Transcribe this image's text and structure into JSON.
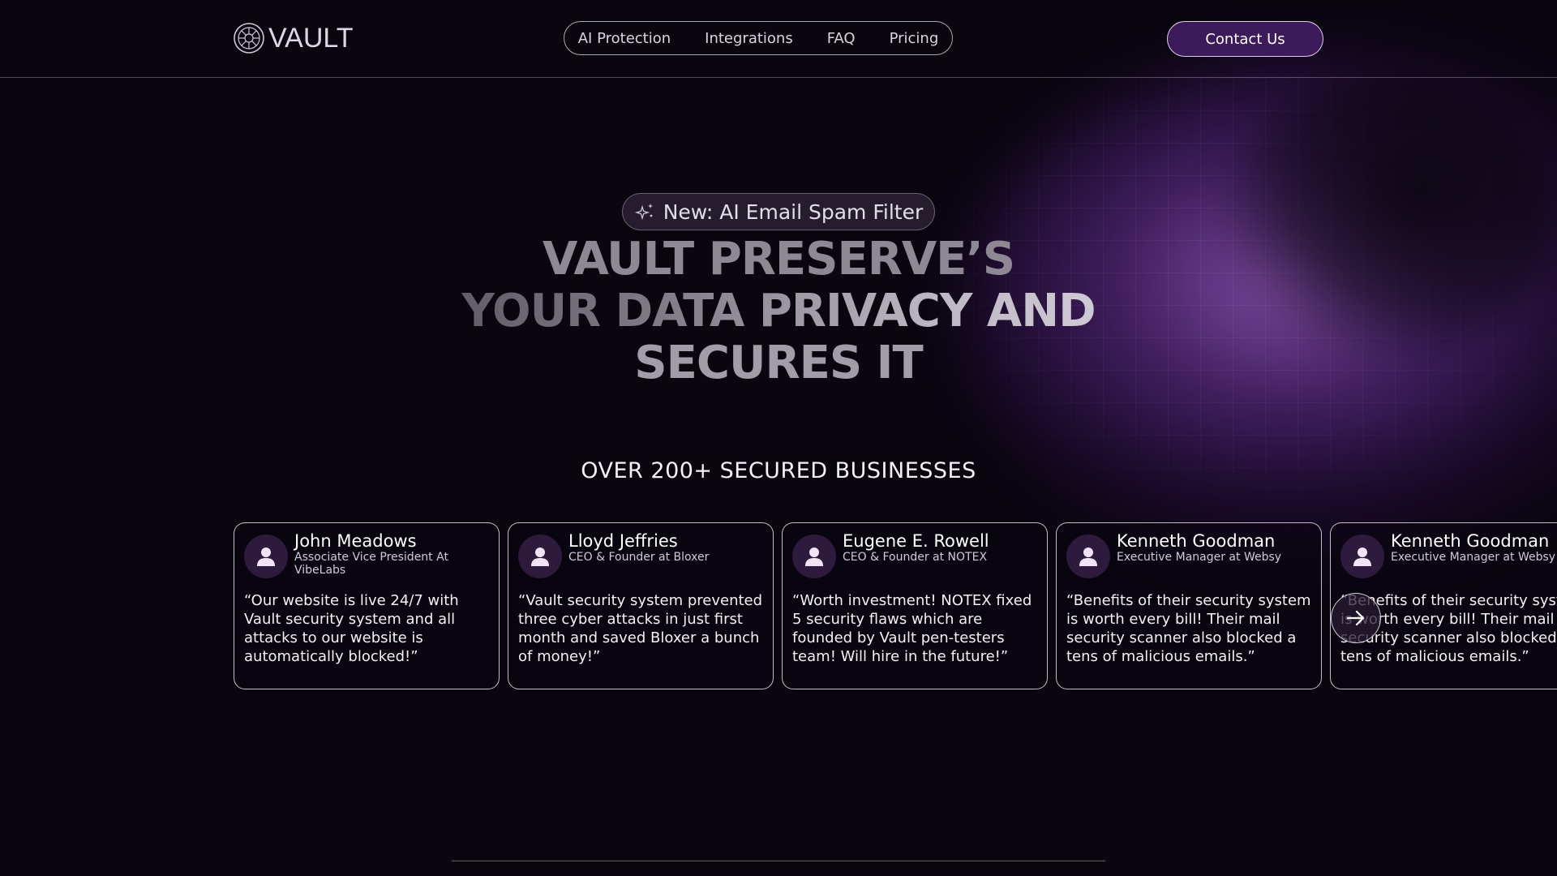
{
  "header": {
    "logo_text": "VAULT",
    "nav": [
      {
        "label": "AI Protection"
      },
      {
        "label": "Integrations"
      },
      {
        "label": "FAQ"
      },
      {
        "label": "Pricing"
      }
    ],
    "contact_label": "Contact Us"
  },
  "hero": {
    "badge_text": "New: AI Email Spam Filter",
    "title_lines": [
      "VAULT PRESERVE’S",
      "YOUR DATA PRIVACY AND",
      "SECURES IT"
    ],
    "secured_text": "OVER 200+ SECURED BUSINESSES"
  },
  "testimonials": [
    {
      "name": "John Meadows",
      "role": "Associate Vice President At VibeLabs",
      "quote": "“Our website is live 24/7 with Vault security system and all attacks to our website is automatically blocked!”"
    },
    {
      "name": "Lloyd Jeffries",
      "role": "CEO & Founder at Bloxer",
      "quote": "“Vault security system prevented three cyber attacks in just first month and saved Bloxer a bunch of money!”"
    },
    {
      "name": "Eugene E. Rowell",
      "role": "CEO & Founder at NOTEX",
      "quote": "“Worth investment! NOTEX fixed 5 security flaws which are founded by Vault pen-testers team! Will hire in the future!”"
    },
    {
      "name": "Kenneth Goodman",
      "role": "Executive Manager at Websy",
      "quote": "“Benefits of their security system is worth every bill! Their mail security scanner also blocked a tens of malicious emails.”"
    },
    {
      "name": "Kenneth Goodman",
      "role": "Executive Manager at Websy",
      "quote": "“Benefits of their security system is worth every bill! Their mail security scanner also blocked a tens of malicious emails.”"
    }
  ],
  "icons": {
    "logo": "vault-logo-icon",
    "badge": "sparkle-icon",
    "avatar": "user-icon",
    "next": "arrow-right-icon"
  },
  "colors": {
    "background": "#0a0610",
    "accent": "#3d1a5b",
    "glow": "#8a4fb8"
  }
}
